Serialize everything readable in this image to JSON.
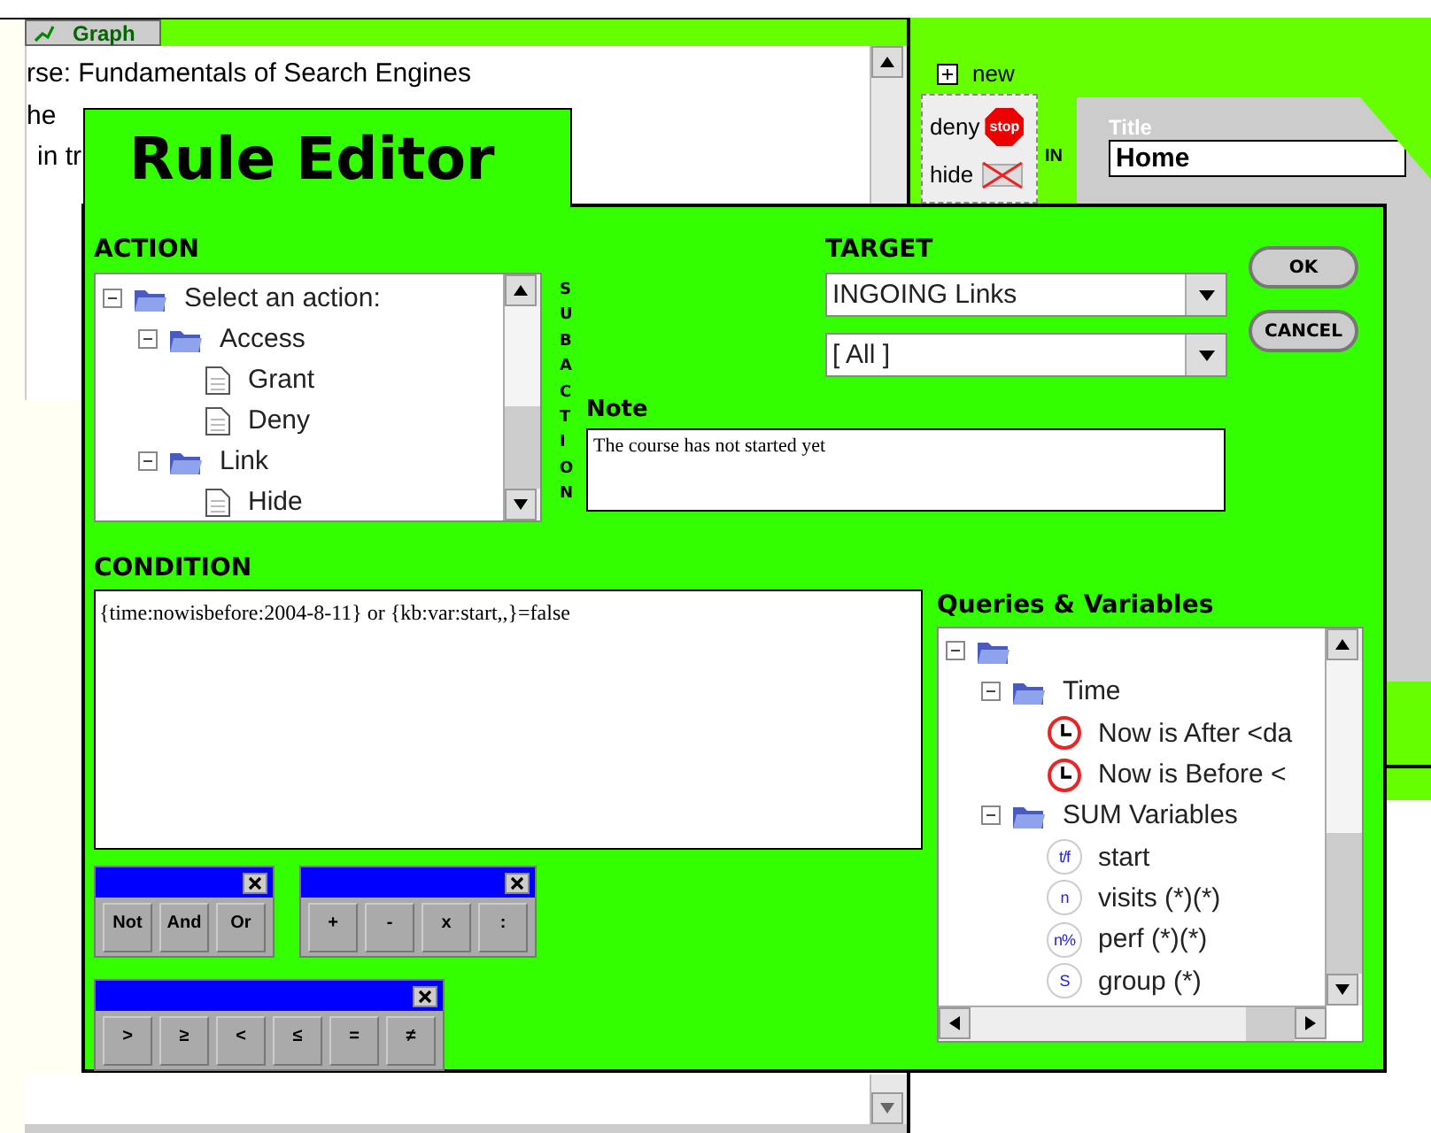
{
  "background": {
    "tab": "Graph",
    "lines": [
      "rse: Fundamentals of Search Engines",
      "he",
      "in tr"
    ],
    "palette": {
      "new_label": "new",
      "items": [
        {
          "label": "deny",
          "kind": "stop",
          "sign": "stop"
        },
        {
          "label": "hide",
          "kind": "hidden"
        }
      ],
      "side_letters": "IN"
    },
    "title_label": "Title",
    "title_value": "Home"
  },
  "dialog": {
    "title": "Rule Editor",
    "action": {
      "label": "ACTION",
      "tree": [
        {
          "label": "Select an action:",
          "kind": "folder",
          "expanded": true,
          "children": [
            {
              "label": "Access",
              "kind": "folder",
              "expanded": true,
              "children": [
                {
                  "label": "Grant",
                  "kind": "page"
                },
                {
                  "label": "Deny",
                  "kind": "page"
                }
              ]
            },
            {
              "label": "Link",
              "kind": "folder",
              "expanded": true,
              "children": [
                {
                  "label": "Hide",
                  "kind": "page"
                }
              ]
            }
          ]
        }
      ]
    },
    "subaction_label": "SUBACTION",
    "target": {
      "label": "TARGET",
      "selects": [
        "INGOING Links",
        "[ All ]"
      ]
    },
    "buttons": [
      "OK",
      "CANCEL"
    ],
    "note": {
      "label": "Note",
      "value": "The course has not started yet"
    },
    "condition": {
      "label": "CONDITION",
      "value": "{time:nowisbefore:2004-8-11}  or {kb:var:start,,}=false"
    },
    "palettes": [
      [
        "Not",
        "And",
        "Or"
      ],
      [
        "+",
        "-",
        "x",
        ":"
      ],
      [
        ">",
        "≥",
        "<",
        "≤",
        "=",
        "≠"
      ]
    ],
    "queries": {
      "label": "Queries & Variables",
      "tree": [
        {
          "kind": "folder",
          "expanded": true,
          "children": [
            {
              "label": "Time",
              "kind": "folder",
              "expanded": true,
              "children": [
                {
                  "label": "Now is After <da",
                  "kind": "clock"
                },
                {
                  "label": "Now is Before <",
                  "kind": "clock"
                }
              ]
            },
            {
              "label": "SUM Variables",
              "kind": "folder",
              "expanded": true,
              "children": [
                {
                  "label": "start",
                  "kind": "variable",
                  "badge": "t/f"
                },
                {
                  "label": "visits (*)(*)",
                  "kind": "variable",
                  "badge": "n"
                },
                {
                  "label": "perf (*)(*)",
                  "kind": "variable",
                  "badge": "n%"
                },
                {
                  "label": "group (*)",
                  "kind": "variable",
                  "badge": "S"
                }
              ]
            }
          ]
        }
      ]
    }
  }
}
